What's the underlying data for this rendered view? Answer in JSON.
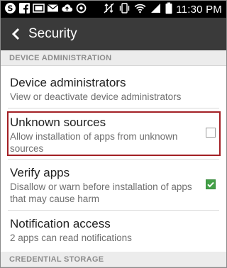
{
  "statusbar": {
    "left_icons": [
      "skype-icon",
      "facebook-icon",
      "image-icon",
      "mail-icon",
      "cloud-upload-icon",
      "sync-icon"
    ],
    "right_icons": [
      "data-disabled-icon",
      "vibrate-icon",
      "wifi-icon",
      "signal-icon",
      "battery-icon"
    ],
    "time": "11:30 PM"
  },
  "actionbar": {
    "title": "Security"
  },
  "sections": {
    "device_admin": "DEVICE ADMINISTRATION",
    "credential_storage": "CREDENTIAL STORAGE"
  },
  "items": [
    {
      "title": "Device administrators",
      "summary": "View or deactivate device administrators"
    },
    {
      "title": "Unknown sources",
      "summary_line1": "Allow installation of apps from unknown",
      "summary_line2": "sources",
      "checked": false
    },
    {
      "title": "Verify apps",
      "summary_line1": "Disallow or warn before installation of apps",
      "summary_line2": "that may cause harm",
      "checked": true
    },
    {
      "title": "Notification access",
      "summary": "2 apps can read notifications"
    }
  ],
  "colors": {
    "actionbar": "#3a3a3a",
    "highlight": "#a32025",
    "checkbox_checked": "#43a047"
  }
}
